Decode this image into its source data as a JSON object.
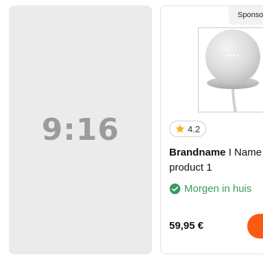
{
  "placeholder": {
    "ratio": "9:16"
  },
  "product": {
    "sponsored_label": "Sponsored",
    "rating": "4.2",
    "brand": "Brandname",
    "title_rest": " I Name",
    "title_line2": "product 1",
    "delivery": "Morgen in huis",
    "price": "59,95 €",
    "icons": {
      "rating": "star-icon",
      "delivery": "check-circle-icon"
    },
    "colors": {
      "star": "#f2b51d",
      "delivery": "#3a9a5b",
      "button": "#fa5a12"
    }
  }
}
